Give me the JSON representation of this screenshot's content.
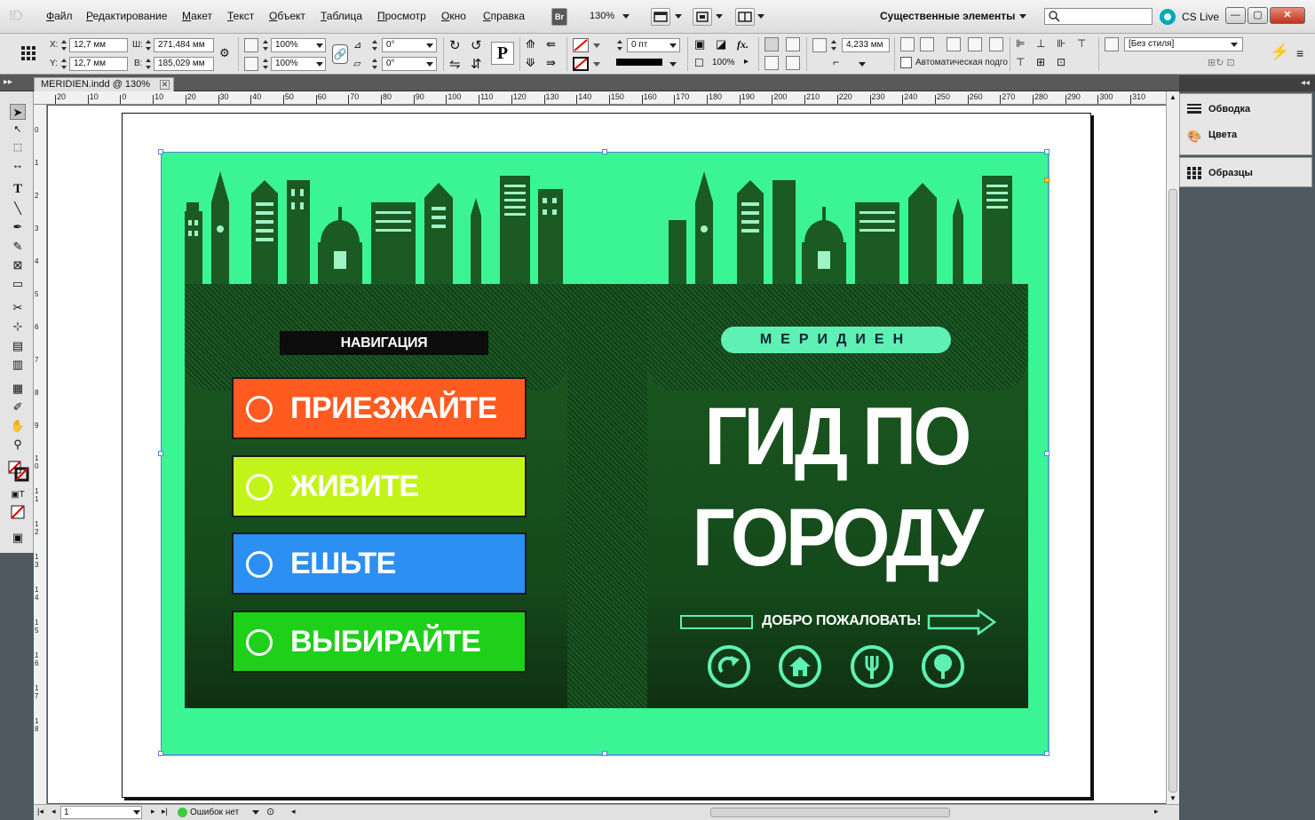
{
  "app": {
    "logo": "ID"
  },
  "menu": [
    "Файл",
    "Редактирование",
    "Макет",
    "Текст",
    "Объект",
    "Таблица",
    "Просмотр",
    "Окно",
    "Справка"
  ],
  "menubar": {
    "bridge": "Br",
    "zoom": "130%",
    "workspace": "Существенные элементы",
    "cs_live": "CS Live"
  },
  "control": {
    "x_label": "X:",
    "x_value": "12,7 мм",
    "y_label": "Y:",
    "y_value": "12,7 мм",
    "w_label": "Ш:",
    "w_value": "271,484 мм",
    "h_label": "В:",
    "h_value": "185,029 мм",
    "scale_x": "100%",
    "scale_y": "100%",
    "rotate": "0°",
    "shear": "0°",
    "stroke_weight": "0 пт",
    "opacity": "100%",
    "fx": "fx.",
    "offset": "4,233 мм",
    "auto_fit": "Автоматическая подгонка",
    "style": "[Без стиля]"
  },
  "document": {
    "tab_title": "MERIDIEN.indd @ 130%"
  },
  "ruler": {
    "h": [
      "20",
      "10",
      "0",
      "10",
      "20",
      "30",
      "40",
      "50",
      "60",
      "70",
      "80",
      "90",
      "100",
      "110",
      "120",
      "130",
      "140",
      "150",
      "160",
      "170",
      "180",
      "190",
      "200",
      "210",
      "220",
      "230",
      "240",
      "250",
      "260",
      "270",
      "280",
      "290",
      "300",
      "310"
    ],
    "v": [
      "0",
      "1",
      "2",
      "3",
      "4",
      "5",
      "6",
      "7",
      "8",
      "9",
      "1 0",
      "1 1",
      "1 2",
      "1 3",
      "1 4",
      "1 5",
      "1 6",
      "1 7",
      "1 8"
    ]
  },
  "design": {
    "nav_label": "НАВИГАЦИЯ",
    "buttons": [
      {
        "label": "ПРИЕЗЖАЙТЕ",
        "color": "#ff5a1f"
      },
      {
        "label": "ЖИВИТЕ",
        "color": "#c3f41a"
      },
      {
        "label": "ЕШЬТЕ",
        "color": "#2c8ff2"
      },
      {
        "label": "ВЫБИРАЙТЕ",
        "color": "#1ed01a"
      }
    ],
    "brand": "МЕРИДИЕН",
    "headline_1": "ГИД ПО",
    "headline_2": "ГОРОДУ",
    "welcome": "ДОБРО ПОЖАЛОВАТЬ!",
    "bg_color": "#3bf595",
    "board_color": "#1b5a22",
    "accent": "#5ff0b5"
  },
  "panels": {
    "stroke": "Обводка",
    "color": "Цвета",
    "swatches": "Образцы"
  },
  "status": {
    "page": "1",
    "errors": "Ошибок нет"
  }
}
